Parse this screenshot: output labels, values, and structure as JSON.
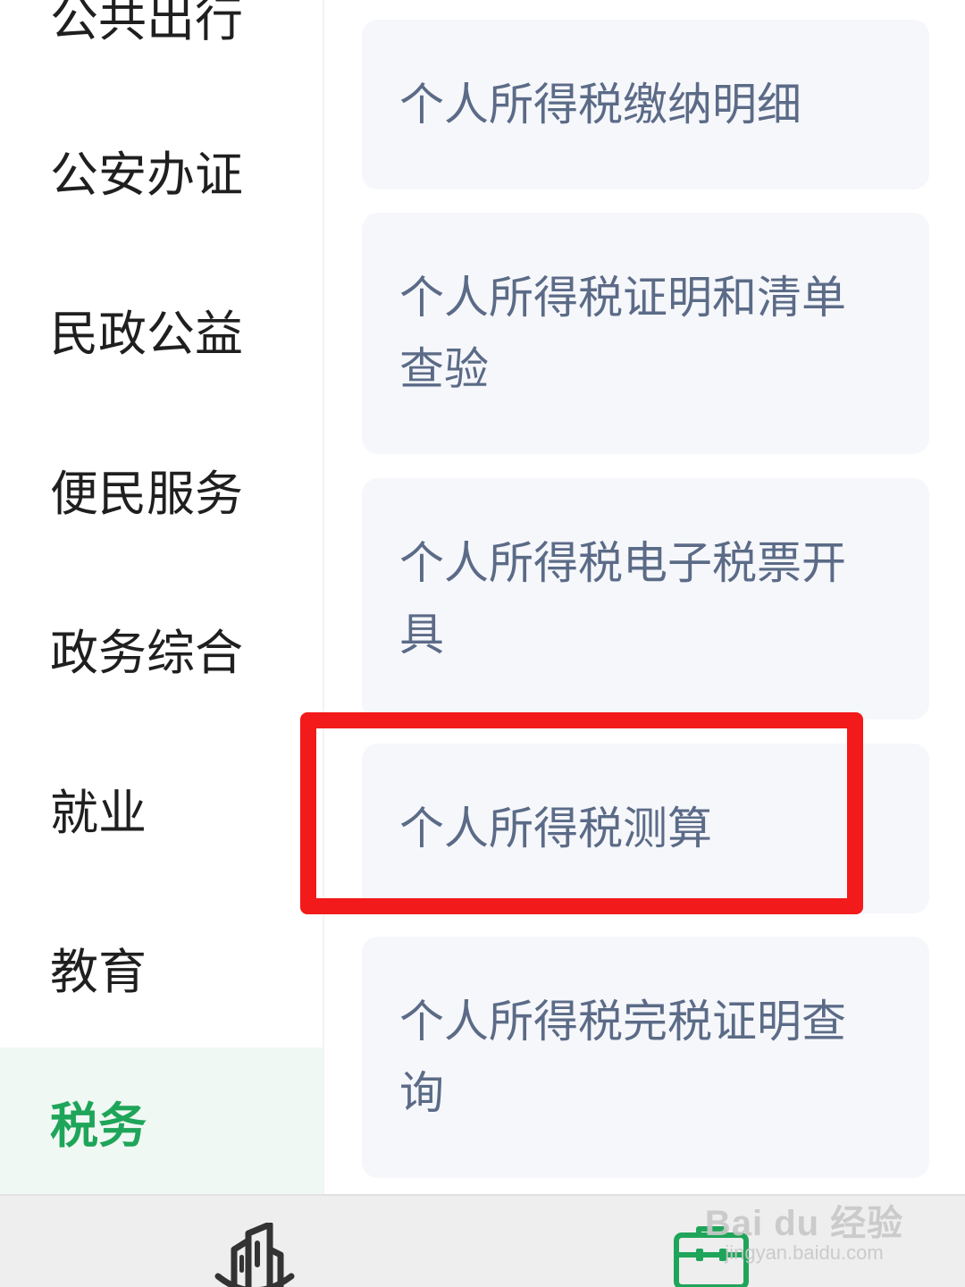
{
  "sidebar": {
    "items": [
      {
        "label": "公共出行"
      },
      {
        "label": "公安办证"
      },
      {
        "label": "民政公益"
      },
      {
        "label": "便民服务"
      },
      {
        "label": "政务综合"
      },
      {
        "label": "就业"
      },
      {
        "label": "教育"
      },
      {
        "label": "税务",
        "active": true
      }
    ]
  },
  "services": [
    {
      "label": "个人所得税缴纳明细"
    },
    {
      "label": "个人所得税证明和清单查验"
    },
    {
      "label": "个人所得税电子税票开具"
    },
    {
      "label": "个人所得税测算",
      "highlighted": true
    },
    {
      "label": "个人所得税完税证明查询"
    }
  ],
  "tabbar": {
    "tabs": [
      {
        "icon": "city-building-icon",
        "color": "#333333"
      },
      {
        "icon": "briefcase-icon",
        "color": "#1fa55a",
        "active": true
      }
    ]
  },
  "watermark": {
    "logo": "Bai du 经验",
    "url": "jingyan.baidu.com"
  },
  "colors": {
    "accent": "#1fa55a",
    "highlight": "#f21a1a",
    "card_text": "#5b6b87",
    "card_bg": "#f6f7fb"
  }
}
